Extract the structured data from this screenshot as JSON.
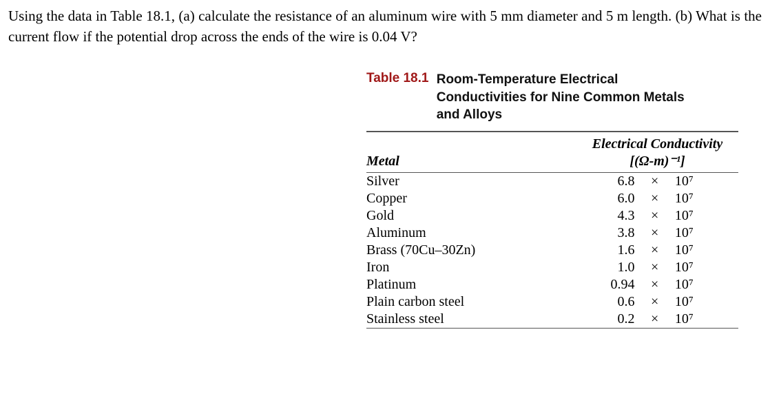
{
  "question": "Using the data in Table 18.1, (a) calculate the resistance of an aluminum wire with 5 mm diameter and 5 m length. (b) What is the current flow if the potential drop across the ends of the wire is 0.04 V?",
  "table": {
    "label": "Table 18.1",
    "title": "Room-Temperature Electrical Conductivities for Nine Common Metals and Alloys",
    "header_metal": "Metal",
    "header_cond_line1": "Electrical Conductivity",
    "header_cond_line2": "[(Ω-m)⁻¹]",
    "rows": [
      {
        "metal": "Silver",
        "coef": "6.8",
        "times": "×",
        "base": "10⁷"
      },
      {
        "metal": "Copper",
        "coef": "6.0",
        "times": "×",
        "base": "10⁷"
      },
      {
        "metal": "Gold",
        "coef": "4.3",
        "times": "×",
        "base": "10⁷"
      },
      {
        "metal": "Aluminum",
        "coef": "3.8",
        "times": "×",
        "base": "10⁷"
      },
      {
        "metal": "Brass (70Cu–30Zn)",
        "coef": "1.6",
        "times": "×",
        "base": "10⁷"
      },
      {
        "metal": "Iron",
        "coef": "1.0",
        "times": "×",
        "base": "10⁷"
      },
      {
        "metal": "Platinum",
        "coef": "0.94",
        "times": "×",
        "base": "10⁷"
      },
      {
        "metal": "Plain carbon steel",
        "coef": "0.6",
        "times": "×",
        "base": "10⁷"
      },
      {
        "metal": "Stainless steel",
        "coef": "0.2",
        "times": "×",
        "base": "10⁷"
      }
    ]
  },
  "chart_data": {
    "type": "table",
    "title": "Room-Temperature Electrical Conductivities for Nine Common Metals and Alloys",
    "columns": [
      "Metal",
      "Electrical Conductivity [(Ω-m)^-1]"
    ],
    "rows": [
      [
        "Silver",
        68000000.0
      ],
      [
        "Copper",
        60000000.0
      ],
      [
        "Gold",
        43000000.0
      ],
      [
        "Aluminum",
        38000000.0
      ],
      [
        "Brass (70Cu–30Zn)",
        16000000.0
      ],
      [
        "Iron",
        10000000.0
      ],
      [
        "Platinum",
        9400000.0
      ],
      [
        "Plain carbon steel",
        6000000.0
      ],
      [
        "Stainless steel",
        2000000.0
      ]
    ]
  }
}
